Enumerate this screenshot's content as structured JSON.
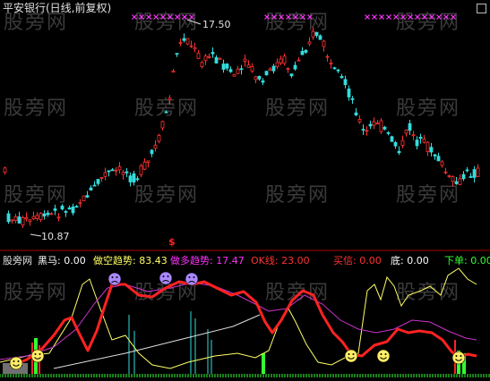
{
  "main_panel": {
    "title": "平安银行(日线,前复权)",
    "high_label": "17.50",
    "low_label": "10.87",
    "signal_marker": "$",
    "watermark": "股旁网"
  },
  "indicator_panel": {
    "name": "股旁网",
    "items": [
      {
        "label": "黑马",
        "value": "0.00",
        "color": "#ffffff"
      },
      {
        "label": "做空趋势",
        "value": "83.43",
        "color": "#ffff66"
      },
      {
        "label": "做多趋势",
        "value": "17.47",
        "color": "#ff33ff"
      },
      {
        "label": "OK线",
        "value": "23.00",
        "color": "#ff3333"
      },
      {
        "label": "买信",
        "value": "0.00",
        "color": "#ff3333"
      },
      {
        "label": "底",
        "value": "0.00",
        "color": "#ffffff"
      },
      {
        "label": "下单",
        "value": "0.00",
        "color": "#33ff33"
      }
    ],
    "watermark": "股旁网"
  },
  "colors": {
    "background": "#000000",
    "up_candle": "#ff3333",
    "down_candle": "#33dddd",
    "divider": "#aa0000",
    "ok_line": "#ff2222",
    "short_trend": "#ffff66",
    "long_trend": "#cc33cc",
    "marker_x": "#ff33ff"
  }
}
